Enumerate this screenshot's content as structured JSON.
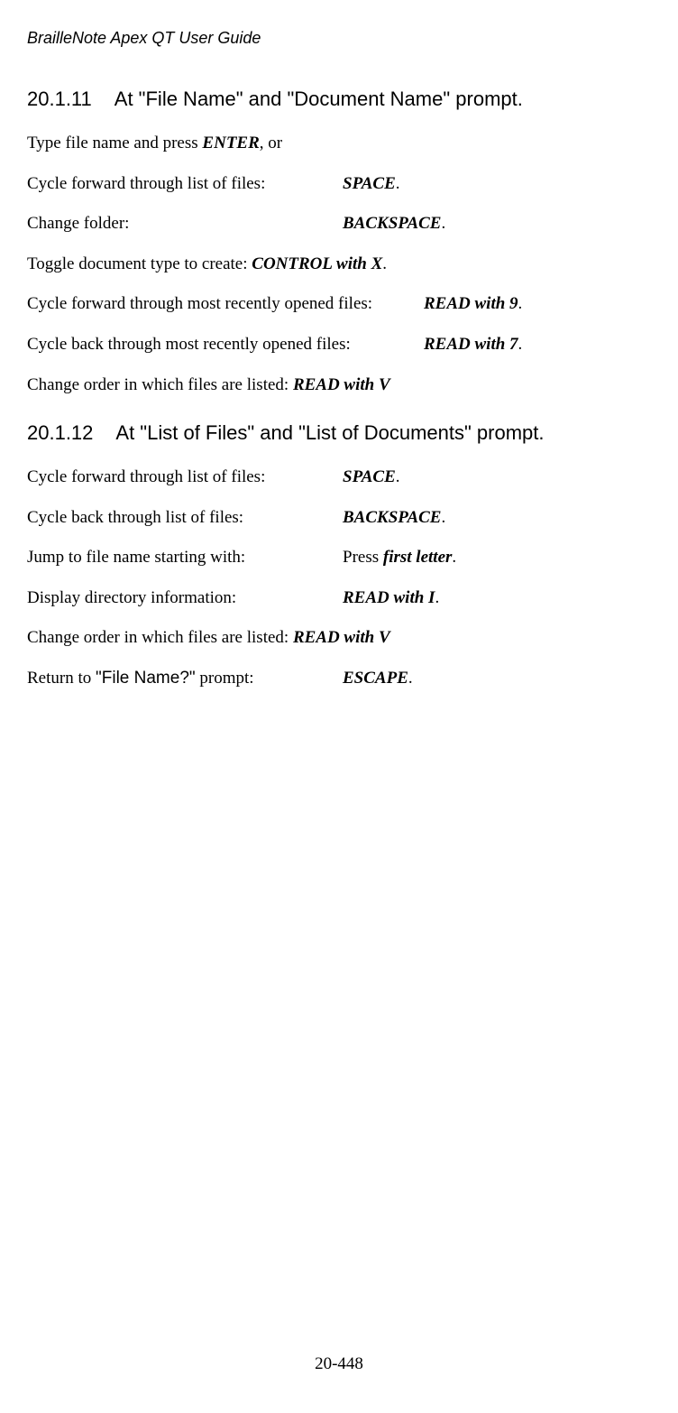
{
  "header": "BrailleNote Apex QT User Guide",
  "section1": {
    "number": "20.1.11",
    "title": "At \"File Name\" and \"Document Name\" prompt.",
    "intro_pre": "Type file name and press ",
    "intro_key": "ENTER",
    "intro_post": ", or",
    "rows": [
      {
        "label": "Cycle forward through list of files:",
        "key": "SPACE",
        "post": "."
      },
      {
        "label": "Change folder:",
        "key": "BACKSPACE",
        "post": "."
      }
    ],
    "inline1_pre": "Toggle document type to create: ",
    "inline1_key": "CONTROL with X",
    "inline1_post": ".",
    "wide_rows": [
      {
        "label": "Cycle forward through most recently opened files:",
        "key": "READ with 9",
        "post": "."
      },
      {
        "label": "Cycle back through most recently opened files:",
        "key": "READ with 7",
        "post": "."
      }
    ],
    "inline2_pre": "Change order in which files are listed: ",
    "inline2_key": "READ with V",
    "inline2_post": ""
  },
  "section2": {
    "number": "20.1.12",
    "title": "At \"List of Files\" and \"List of Documents\" prompt.",
    "rows": [
      {
        "label": "Cycle forward through list of files:",
        "key": "SPACE",
        "post": "."
      },
      {
        "label": "Cycle back through list of files:",
        "key": "BACKSPACE",
        "post": "."
      },
      {
        "label": "Jump to file name starting with:",
        "pre": "Press ",
        "key": "first letter",
        "post": "."
      },
      {
        "label": "Display directory information:",
        "key": "READ with I",
        "post": "."
      }
    ],
    "inline1_pre": "Change order in which files are listed: ",
    "inline1_key": "READ with V",
    "inline1_post": "",
    "last_row": {
      "label_pre": "Return to ",
      "label_prompt": "\"File Name?\"",
      "label_post": " prompt:",
      "key": "ESCAPE",
      "post": "."
    }
  },
  "footer": "20-448"
}
